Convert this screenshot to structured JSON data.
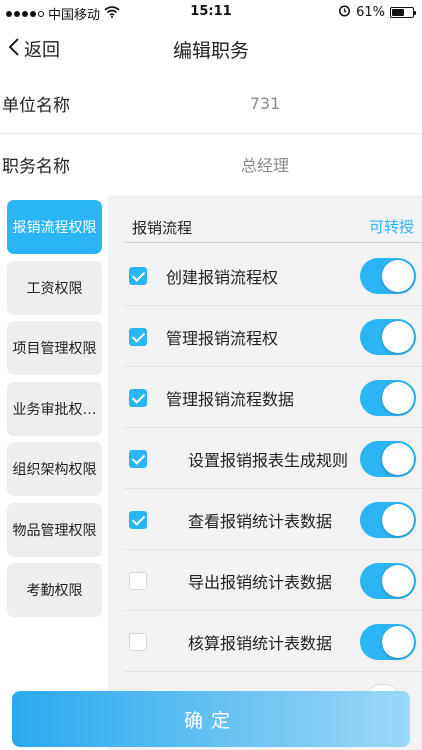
{
  "status_bar": {
    "carrier": "中国移动",
    "time": "15:11",
    "battery_percent": "61%",
    "battery_level": 0.61
  },
  "nav": {
    "back_label": "返回",
    "title": "编辑职务"
  },
  "form": {
    "unit_label": "单位名称",
    "unit_value": "731",
    "position_label": "职务名称",
    "position_value": "总经理"
  },
  "tabs": [
    {
      "label": "报销流程权限",
      "active": true
    },
    {
      "label": "工资权限",
      "active": false
    },
    {
      "label": "项目管理权限",
      "active": false
    },
    {
      "label": "业务审批权…",
      "active": false
    },
    {
      "label": "组织架构权限",
      "active": false
    },
    {
      "label": "物品管理权限",
      "active": false
    },
    {
      "label": "考勤权限",
      "active": false
    }
  ],
  "section": {
    "title": "报销流程",
    "action": "可转授"
  },
  "permissions": [
    {
      "label": "创建报销流程权",
      "checked": true,
      "enabled": true
    },
    {
      "label": "管理报销流程权",
      "checked": true,
      "enabled": true
    },
    {
      "label": "管理报销流程数据",
      "checked": true,
      "enabled": true
    },
    {
      "label": "设置报销报表生成规则",
      "checked": true,
      "enabled": true
    },
    {
      "label": "查看报销统计表数据",
      "checked": true,
      "enabled": true
    },
    {
      "label": "导出报销统计表数据",
      "checked": false,
      "enabled": true
    },
    {
      "label": "核算报销统计表数据",
      "checked": false,
      "enabled": true
    }
  ],
  "confirm_label": "确定",
  "colors": {
    "accent": "#2bb5f5",
    "tab_inactive": "#eeeeee",
    "panel_bg": "#f2f2f2"
  }
}
